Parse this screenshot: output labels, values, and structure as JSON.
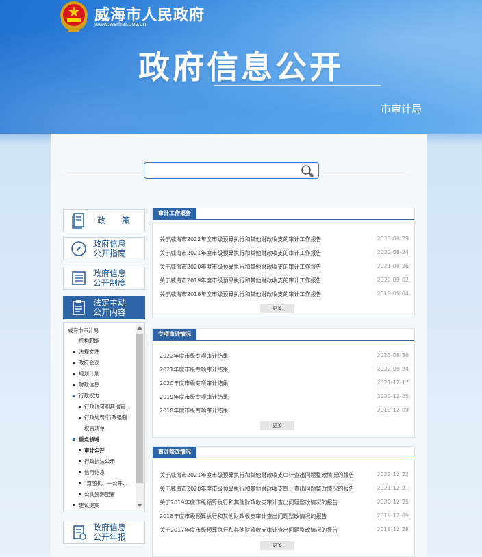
{
  "header": {
    "site_name": "威海市人民政府",
    "site_url": "www.weihai.gov.cn",
    "big_title": "政府信息公开",
    "dept_name": "市审计局"
  },
  "search": {
    "placeholder": ""
  },
  "sidebar": {
    "nav": [
      {
        "label": "政　策"
      },
      {
        "label": "政府信息\n公开指南"
      },
      {
        "label": "政府信息\n公开制度"
      },
      {
        "label": "法定主动\n公开内容"
      },
      {
        "label": "政府信息\n公开年报"
      }
    ],
    "tree": [
      {
        "label": "威海市审计局"
      },
      {
        "label": "机构职能"
      },
      {
        "label": "法规文件"
      },
      {
        "label": "政府会议"
      },
      {
        "label": "规划计划"
      },
      {
        "label": "财政信息"
      },
      {
        "label": "行政权力"
      },
      {
        "label": "行政许可和其他管..."
      },
      {
        "label": "行政处罚/行政强制"
      },
      {
        "label": "权责清单"
      },
      {
        "label": "重点领域"
      },
      {
        "label": "审计公开"
      },
      {
        "label": "行政执法公示"
      },
      {
        "label": "信用信息"
      },
      {
        "label": "\"双随机、一公开..."
      },
      {
        "label": "公共资源配置"
      },
      {
        "label": "建议提案"
      }
    ]
  },
  "sections": [
    {
      "title": "审计工作报告",
      "more": "更多",
      "rows": [
        {
          "title": "关于威海市2022年度市级预算执行和其他财政收支的审计工作报告",
          "date": "2023-08-29"
        },
        {
          "title": "关于威海市2021年度市级预算执行和其他财政收支的审计工作报告",
          "date": "2022-08-24"
        },
        {
          "title": "关于威海市2020年度市级预算执行和其他财政收支的审计工作报告",
          "date": "2021-08-26"
        },
        {
          "title": "关于威海市2019年度市级预算执行和其他财政收支的审计工作报告",
          "date": "2020-09-02"
        },
        {
          "title": "关于威海市2018年度市级预算执行和其他财政收支的审计工作报告",
          "date": "2019-09-04"
        }
      ]
    },
    {
      "title": "专项审计情况",
      "more": "更多",
      "rows": [
        {
          "title": "2022年度市级专项审计结果",
          "date": "2023-08-30"
        },
        {
          "title": "2021年度市级专项审计结果",
          "date": "2022-08-24"
        },
        {
          "title": "2020年度市级专项审计结果",
          "date": "2021-12-17"
        },
        {
          "title": "2019年度市级专项审计结果",
          "date": "2020-12-25"
        },
        {
          "title": "2018年度市级专项审计结果",
          "date": "2019-12-09"
        }
      ]
    },
    {
      "title": "审计整改情况",
      "more": "更多",
      "rows": [
        {
          "title": "关于威海市2021年度市级预算执行和其他财政收支审计查出问题整改情况的报告",
          "date": "2022-12-22"
        },
        {
          "title": "关于威海市2020年度市级预算执行和其他财政收支审计查出问题整改情况的报告",
          "date": "2021-12-21"
        },
        {
          "title": "关于2019年度市级预算执行和其他财政收支审计查出问题整改情况的报告",
          "date": "2020-12-25"
        },
        {
          "title": "2018年度市级预算执行和其他财政收支审计查出问题整改情况的报告",
          "date": "2019-12-09"
        },
        {
          "title": "关于2017年度市级预算执行和其他财政收支审计查出问题整改情况的报告",
          "date": "2018-12-28"
        }
      ]
    }
  ],
  "colors": {
    "primary": "#2c64a6",
    "header": "#2f7fd6"
  }
}
